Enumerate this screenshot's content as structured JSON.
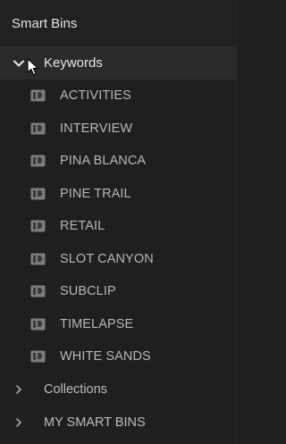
{
  "header": {
    "title": "Smart Bins"
  },
  "keywords_group": {
    "label": "Keywords",
    "expanded": true,
    "items": [
      {
        "label": "ACTIVITIES",
        "icon": "keyword-bin-icon"
      },
      {
        "label": "INTERVIEW",
        "icon": "keyword-bin-icon"
      },
      {
        "label": "PINA BLANCA",
        "icon": "keyword-bin-icon"
      },
      {
        "label": "PINE TRAIL",
        "icon": "keyword-bin-icon"
      },
      {
        "label": "RETAIL",
        "icon": "keyword-bin-icon"
      },
      {
        "label": "SLOT CANYON",
        "icon": "keyword-bin-icon"
      },
      {
        "label": "SUBCLIP",
        "icon": "keyword-bin-icon"
      },
      {
        "label": "TIMELAPSE",
        "icon": "keyword-bin-icon"
      },
      {
        "label": "WHITE SANDS",
        "icon": "keyword-bin-icon"
      }
    ]
  },
  "collections_group": {
    "label": "Collections",
    "expanded": false
  },
  "my_smart_bins_group": {
    "label": "MY SMART BINS",
    "expanded": false
  },
  "colors": {
    "panel_bg": "#1f1f21",
    "selected_row_bg": "#2b2b2e",
    "text_primary": "#e6e6e6",
    "text_item": "#b7b7b7"
  }
}
